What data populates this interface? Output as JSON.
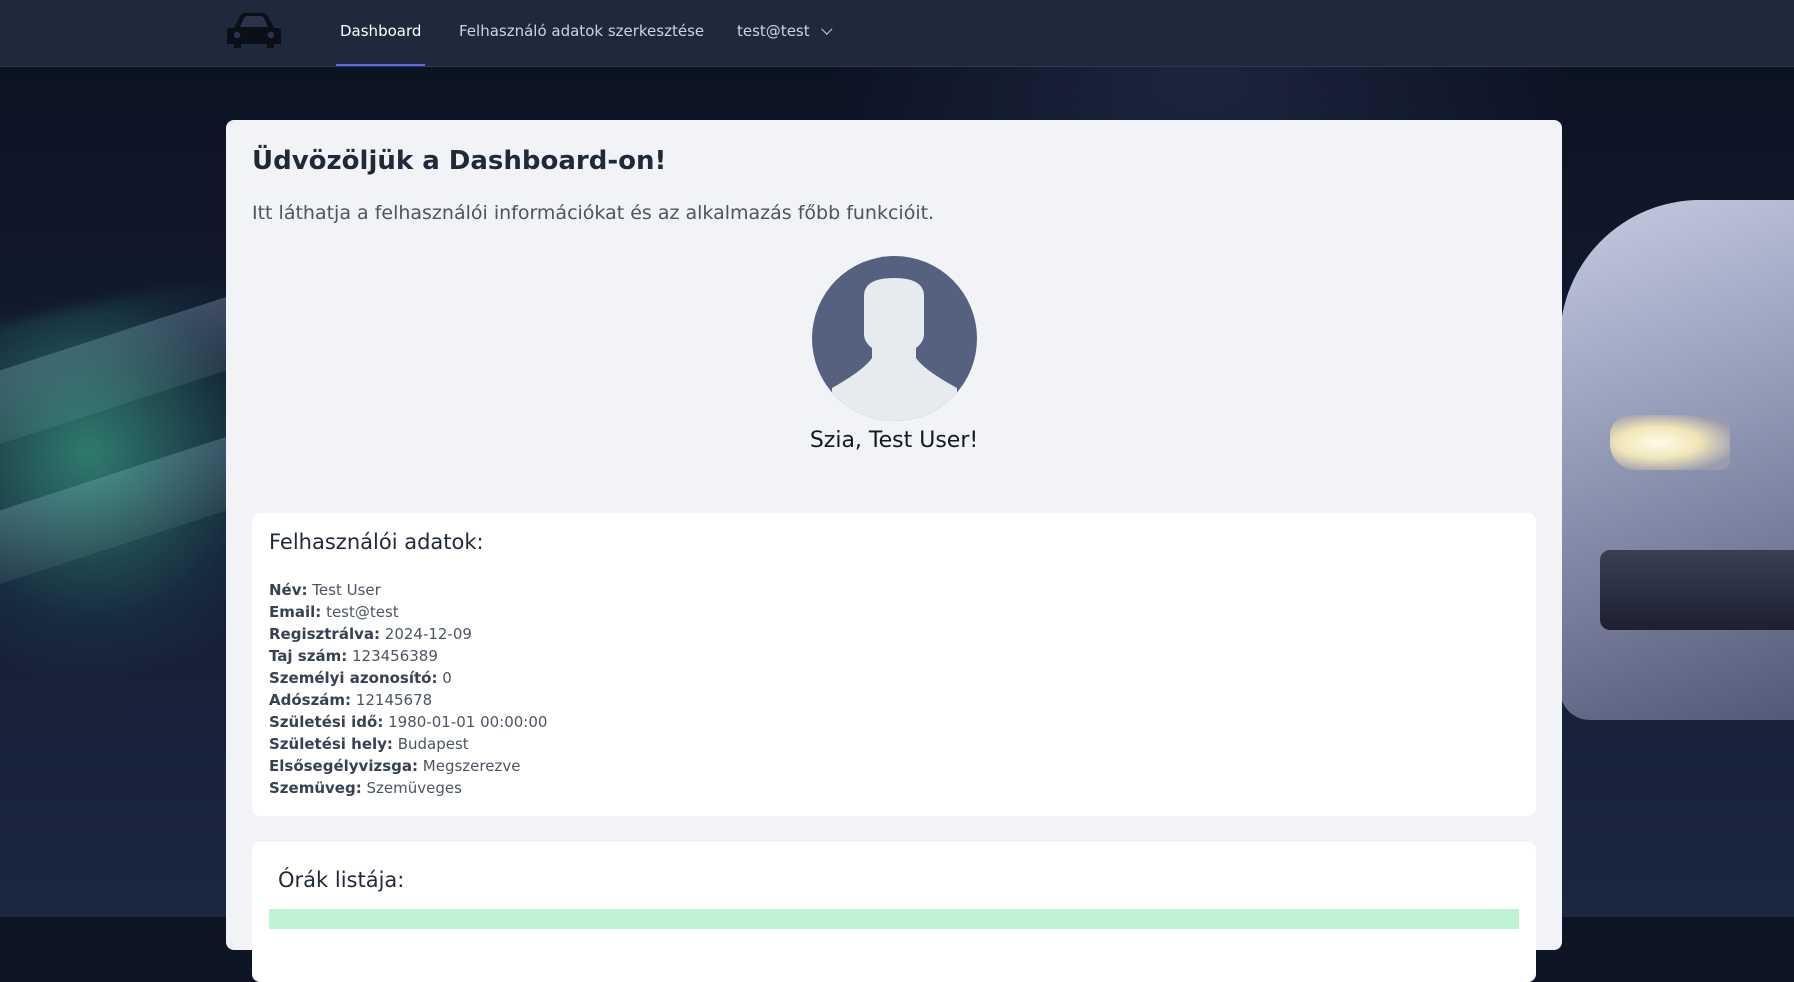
{
  "navbar": {
    "logo_icon": "car-icon",
    "items": [
      {
        "label": "Dashboard",
        "active": true
      },
      {
        "label": "Felhasználó adatok szerkesztése",
        "active": false
      }
    ],
    "user_menu": {
      "label": "test@test",
      "icon": "chevron-down-icon"
    }
  },
  "main": {
    "title": "Üdvözöljük a Dashboard-on!",
    "subtitle": "Itt láthatja a felhasználói információkat és az alkalmazás főbb funkcióit.",
    "avatar_icon": "user-silhouette-icon",
    "greeting": "Szia, Test User!"
  },
  "user_info": {
    "title": "Felhasználói adatok:",
    "fields": [
      {
        "label": "Név:",
        "value": "Test User"
      },
      {
        "label": "Email:",
        "value": "test@test"
      },
      {
        "label": "Regisztrálva:",
        "value": "2024-12-09"
      },
      {
        "label": "Taj szám:",
        "value": "123456389"
      },
      {
        "label": "Személyi azonosító:",
        "value": "0"
      },
      {
        "label": "Adószám:",
        "value": "12145678"
      },
      {
        "label": "Születési idő:",
        "value": "1980-01-01 00:00:00"
      },
      {
        "label": "Születési hely:",
        "value": "Budapest"
      },
      {
        "label": "Elsősegélyvizsga:",
        "value": "Megszerezve"
      },
      {
        "label": "Szemüveg:",
        "value": "Szemüveges"
      }
    ]
  },
  "lessons": {
    "title": "Órák listája:"
  },
  "colors": {
    "navbar_bg": "#1e293b",
    "active_indicator": "#6366f1",
    "card_bg": "#f1f3f6",
    "avatar_bg": "#56607f",
    "lessons_highlight": "#bff3d6"
  }
}
